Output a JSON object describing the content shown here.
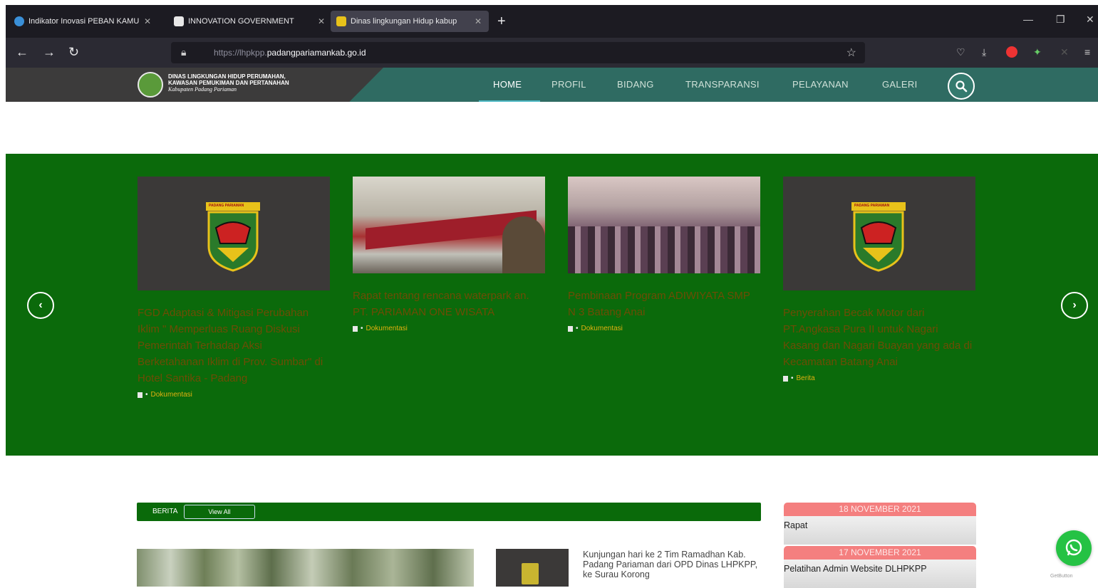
{
  "browser": {
    "tabs": [
      {
        "title": "Indikator Inovasi PEBAN KAMU"
      },
      {
        "title": "INNOVATION GOVERNMENT"
      },
      {
        "title": "Dinas lingkungan Hidup kabup"
      }
    ],
    "url_prefix": "https://lhpkpp.",
    "url_domain": "padangpariamankab.go.id"
  },
  "site": {
    "org_line1": "DINAS LINGKUNGAN HIDUP PERUMAHAN,",
    "org_line2": "KAWASAN PEMUKIMAN DAN PERTANAHAN",
    "org_line3": "Kabupaten Padang Pariaman",
    "menu": [
      "HOME",
      "PROFIL",
      "BIDANG",
      "TRANSPARANSI",
      "PELAYANAN",
      "GALERI"
    ]
  },
  "slider": {
    "cards": [
      {
        "title": "FGD Adaptasi & Mitigasi Perubahan Iklim \" Memperluas Ruang Diskusi Pemerintah Terhadap Aksi Berketahanan Iklim di Prov. Sumbar\" di Hotel Santika - Padang",
        "category": "Dokumentasi",
        "logo_text": "PADANG PARIAMAN"
      },
      {
        "title": "Rapat tentang rencana waterpark an. PT. PARIAMAN ONE WISATA",
        "category": "Dokumentasi"
      },
      {
        "title": "Pembinaan Program ADIWIYATA SMP N 3 Batang Anai",
        "category": "Dokumentasi"
      },
      {
        "title": "Penyerahan Becak Motor dari PT.Angkasa Pura II untuk Nagari Kasang dan Nagari Buayan yang ada di Kecamatan Batang Anai",
        "category": "Berita",
        "logo_text": "PADANG PARIAMAN"
      }
    ]
  },
  "news": {
    "section_label": "BERITA",
    "view_all": "View All",
    "item_text": "Kunjungan hari ke 2 Tim Ramadhan Kab. Padang Pariaman dari OPD Dinas LHPKPP, ke Surau Korong"
  },
  "agenda": [
    {
      "date": "18 NOVEMBER 2021",
      "title": "Rapat"
    },
    {
      "date": "17 NOVEMBER 2021",
      "title": "Pelatihan Admin Website DLHPKPP"
    }
  ],
  "widget": {
    "brand": "GetButton"
  },
  "colors": {
    "header_green": "#2f6b62",
    "slider_green": "#0b6a0b",
    "agenda_pink": "#f47f7f",
    "whatsapp": "#25c244"
  }
}
